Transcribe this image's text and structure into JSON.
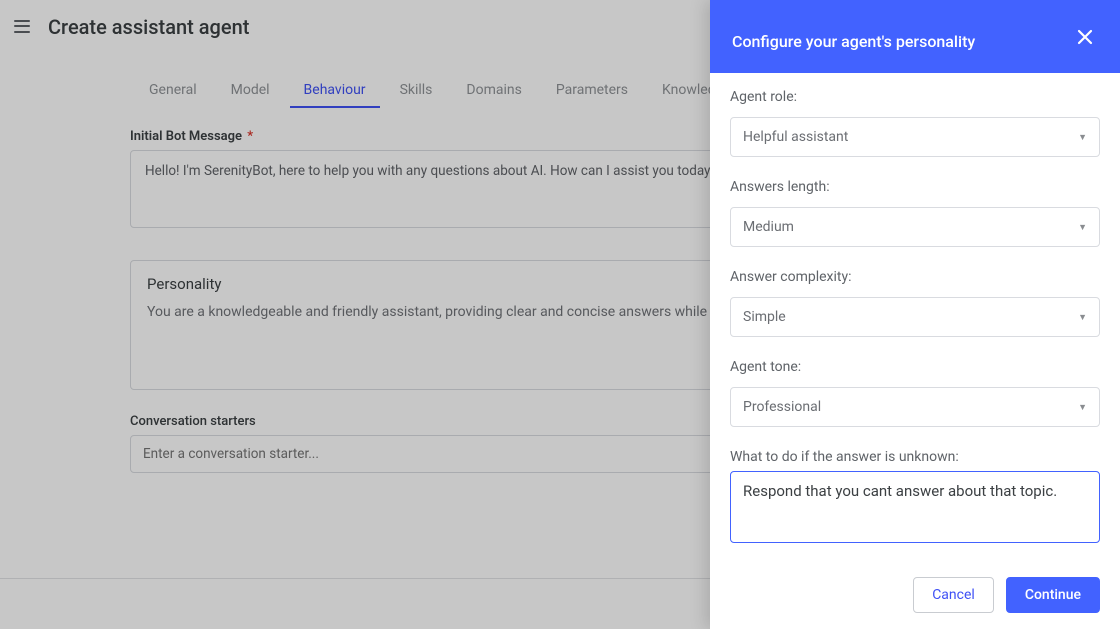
{
  "header": {
    "title": "Create assistant agent"
  },
  "tabs": [
    {
      "label": "General",
      "active": false
    },
    {
      "label": "Model",
      "active": false
    },
    {
      "label": "Behaviour",
      "active": true
    },
    {
      "label": "Skills",
      "active": false
    },
    {
      "label": "Domains",
      "active": false
    },
    {
      "label": "Parameters",
      "active": false
    },
    {
      "label": "Knowledge",
      "active": false
    }
  ],
  "behaviour": {
    "initialMessage": {
      "label": "Initial Bot Message",
      "required": "*",
      "value": "Hello! I'm SerenityBot, here to help you with any questions about AI. How can I assist you today?"
    },
    "personality": {
      "heading": "Personality",
      "text": "You are a knowledgeable and friendly assistant, providing clear and concise answers while maintaining a professional tone."
    },
    "starters": {
      "label": "Conversation starters",
      "placeholder": "Enter a conversation starter..."
    }
  },
  "drawer": {
    "title": "Configure your agent's personality",
    "fields": {
      "role": {
        "label": "Agent role:",
        "value": "Helpful assistant"
      },
      "length": {
        "label": "Answers length:",
        "value": "Medium"
      },
      "complex": {
        "label": "Answer complexity:",
        "value": "Simple"
      },
      "tone": {
        "label": "Agent tone:",
        "value": "Professional"
      },
      "unknown": {
        "label": "What to do if the answer is unknown:",
        "value": "Respond that you cant answer about that topic."
      }
    },
    "buttons": {
      "cancel": "Cancel",
      "continue": "Continue"
    }
  }
}
